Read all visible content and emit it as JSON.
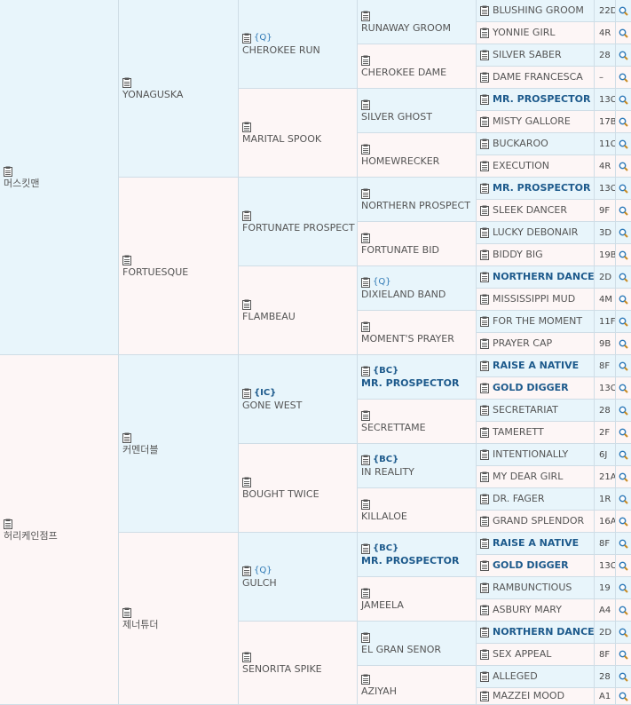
{
  "gen1": [
    {
      "name": "머스킷맨",
      "tag": "",
      "bold": false
    },
    {
      "name": "허리케인점프",
      "tag": "",
      "bold": false
    }
  ],
  "gen2": [
    {
      "name": "YONAGUSKA",
      "tag": "",
      "bold": false
    },
    {
      "name": "FORTUESQUE",
      "tag": "",
      "bold": false
    },
    {
      "name": "커멘더블",
      "tag": "",
      "bold": false
    },
    {
      "name": "제너튜더",
      "tag": "",
      "bold": false
    }
  ],
  "gen3": [
    {
      "name": "CHEROKEE RUN",
      "tag": "{Q}",
      "bold": false,
      "tag_bold": false
    },
    {
      "name": "MARITAL SPOOK",
      "tag": "",
      "bold": false,
      "tag_bold": false
    },
    {
      "name": "FORTUNATE PROSPECT",
      "tag": "",
      "bold": false,
      "tag_bold": false
    },
    {
      "name": "FLAMBEAU",
      "tag": "",
      "bold": false,
      "tag_bold": false
    },
    {
      "name": "GONE WEST",
      "tag": "{IC}",
      "bold": false,
      "tag_bold": true
    },
    {
      "name": "BOUGHT TWICE",
      "tag": "",
      "bold": false,
      "tag_bold": false
    },
    {
      "name": "GULCH",
      "tag": "{Q}",
      "bold": false,
      "tag_bold": false
    },
    {
      "name": "SENORITA SPIKE",
      "tag": "",
      "bold": false,
      "tag_bold": false
    }
  ],
  "gen4": [
    {
      "name": "RUNAWAY GROOM",
      "tag": "",
      "bold": false,
      "tag_bold": false
    },
    {
      "name": "CHEROKEE DAME",
      "tag": "",
      "bold": false,
      "tag_bold": false
    },
    {
      "name": "SILVER GHOST",
      "tag": "",
      "bold": false,
      "tag_bold": false
    },
    {
      "name": "HOMEWRECKER",
      "tag": "",
      "bold": false,
      "tag_bold": false
    },
    {
      "name": "NORTHERN PROSPECT",
      "tag": "",
      "bold": false,
      "tag_bold": false
    },
    {
      "name": "FORTUNATE BID",
      "tag": "",
      "bold": false,
      "tag_bold": false
    },
    {
      "name": "DIXIELAND BAND",
      "tag": "{Q}",
      "bold": false,
      "tag_bold": false
    },
    {
      "name": "MOMENT'S PRAYER",
      "tag": "",
      "bold": false,
      "tag_bold": false
    },
    {
      "name": "MR. PROSPECTOR",
      "tag": "{BC}",
      "bold": true,
      "tag_bold": true
    },
    {
      "name": "SECRETTAME",
      "tag": "",
      "bold": false,
      "tag_bold": false
    },
    {
      "name": "IN REALITY",
      "tag": "{BC}",
      "bold": false,
      "tag_bold": true
    },
    {
      "name": "KILLALOE",
      "tag": "",
      "bold": false,
      "tag_bold": false
    },
    {
      "name": "MR. PROSPECTOR",
      "tag": "{BC}",
      "bold": true,
      "tag_bold": true
    },
    {
      "name": "JAMEELA",
      "tag": "",
      "bold": false,
      "tag_bold": false
    },
    {
      "name": "EL GRAN SENOR",
      "tag": "",
      "bold": false,
      "tag_bold": false
    },
    {
      "name": "AZIYAH",
      "tag": "",
      "bold": false,
      "tag_bold": false
    }
  ],
  "gen5": [
    {
      "name": "BLUSHING GROOM",
      "code": "22D",
      "bold": false
    },
    {
      "name": "YONNIE GIRL",
      "code": "4R",
      "bold": false
    },
    {
      "name": "SILVER SABER",
      "code": "28",
      "bold": false
    },
    {
      "name": "DAME FRANCESCA",
      "code": "–",
      "bold": false
    },
    {
      "name": "MR. PROSPECTOR",
      "code": "13C",
      "bold": true
    },
    {
      "name": "MISTY GALLORE",
      "code": "17B",
      "bold": false
    },
    {
      "name": "BUCKAROO",
      "code": "11C",
      "bold": false
    },
    {
      "name": "EXECUTION",
      "code": "4R",
      "bold": false
    },
    {
      "name": "MR. PROSPECTOR",
      "code": "13C",
      "bold": true
    },
    {
      "name": "SLEEK DANCER",
      "code": "9F",
      "bold": false
    },
    {
      "name": "LUCKY DEBONAIR",
      "code": "3D",
      "bold": false
    },
    {
      "name": "BIDDY BIG",
      "code": "19B",
      "bold": false
    },
    {
      "name": "NORTHERN DANCER",
      "code": "2D",
      "bold": true
    },
    {
      "name": "MISSISSIPPI MUD",
      "code": "4M",
      "bold": false
    },
    {
      "name": "FOR THE MOMENT",
      "code": "11F",
      "bold": false
    },
    {
      "name": "PRAYER CAP",
      "code": "9B",
      "bold": false
    },
    {
      "name": "RAISE A NATIVE",
      "code": "8F",
      "bold": true
    },
    {
      "name": "GOLD DIGGER",
      "code": "13C",
      "bold": true
    },
    {
      "name": "SECRETARIAT",
      "code": "28",
      "bold": false
    },
    {
      "name": "TAMERETT",
      "code": "2F",
      "bold": false
    },
    {
      "name": "INTENTIONALLY",
      "code": "6J",
      "bold": false
    },
    {
      "name": "MY DEAR GIRL",
      "code": "21A",
      "bold": false
    },
    {
      "name": "DR. FAGER",
      "code": "1R",
      "bold": false
    },
    {
      "name": "GRAND SPLENDOR",
      "code": "16A",
      "bold": false
    },
    {
      "name": "RAISE A NATIVE",
      "code": "8F",
      "bold": true
    },
    {
      "name": "GOLD DIGGER",
      "code": "13C",
      "bold": true
    },
    {
      "name": "RAMBUNCTIOUS",
      "code": "19",
      "bold": false
    },
    {
      "name": "ASBURY MARY",
      "code": "A4",
      "bold": false
    },
    {
      "name": "NORTHERN DANCER",
      "code": "2D",
      "bold": true
    },
    {
      "name": "SEX APPEAL",
      "code": "8F",
      "bold": false
    },
    {
      "name": "ALLEGED",
      "code": "28",
      "bold": false
    },
    {
      "name": "MAZZEI MOOD",
      "code": "A1",
      "bold": false
    }
  ],
  "icons": {
    "record": "clipboard-icon",
    "search": "magnifier-icon"
  },
  "colors": {
    "sire_bg": "#e8f5fb",
    "dam_bg": "#fdf6f6",
    "bold_name": "#1d5a8c",
    "tag": "#2f79b5"
  }
}
